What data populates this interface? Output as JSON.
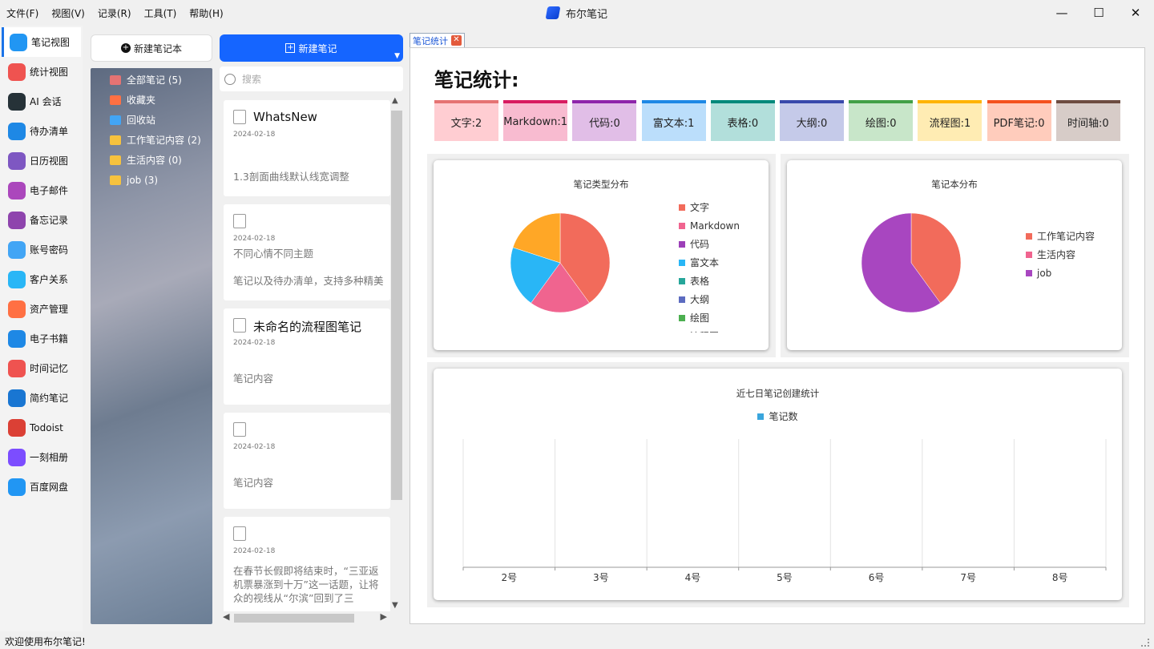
{
  "window": {
    "title": "布尔笔记",
    "menu": [
      "文件(F)",
      "视图(V)",
      "记录(R)",
      "工具(T)",
      "帮助(H)"
    ],
    "controls": {
      "minimize": "—",
      "maximize": "☐",
      "close": "✕"
    }
  },
  "nav": {
    "items": [
      {
        "label": "笔记视图",
        "icon": "note-view-icon",
        "color": "#2196f3"
      },
      {
        "label": "统计视图",
        "icon": "stats-icon",
        "color": "#ef5350"
      },
      {
        "label": "AI 会话",
        "icon": "ai-chat-icon",
        "color": "#263238"
      },
      {
        "label": "待办清单",
        "icon": "todo-icon",
        "color": "#1e88e5"
      },
      {
        "label": "日历视图",
        "icon": "calendar-icon",
        "color": "#7e57c2"
      },
      {
        "label": "电子邮件",
        "icon": "email-icon",
        "color": "#ab47bc"
      },
      {
        "label": "备忘记录",
        "icon": "memo-icon",
        "color": "#8e44ad"
      },
      {
        "label": "账号密码",
        "icon": "password-icon",
        "color": "#42a5f5"
      },
      {
        "label": "客户关系",
        "icon": "customer-icon",
        "color": "#29b6f6"
      },
      {
        "label": "资产管理",
        "icon": "asset-icon",
        "color": "#ff7043"
      },
      {
        "label": "电子书籍",
        "icon": "ebook-icon",
        "color": "#1e88e5"
      },
      {
        "label": "时间记忆",
        "icon": "time-memory-icon",
        "color": "#ef5350"
      },
      {
        "label": "简约笔记",
        "icon": "simple-note-icon",
        "color": "#1976d2"
      },
      {
        "label": "Todoist",
        "icon": "todoist-icon",
        "color": "#db4035"
      },
      {
        "label": "一刻相册",
        "icon": "album-icon",
        "color": "#7c4dff"
      },
      {
        "label": "百度网盘",
        "icon": "baidu-disk-icon",
        "color": "#2196f3"
      }
    ]
  },
  "notebooks": {
    "new_label": "新建笔记本",
    "items": [
      {
        "label": "全部笔记 (5)",
        "icon": "home-icon",
        "color": "#e57373"
      },
      {
        "label": "收藏夹",
        "icon": "favorites-icon",
        "color": "#ff7043"
      },
      {
        "label": "回收站",
        "icon": "trash-icon",
        "color": "#42a5f5"
      },
      {
        "label": "工作笔记内容 (2)",
        "icon": "folder-icon",
        "color": "#f6c23e"
      },
      {
        "label": "生活内容 (0)",
        "icon": "folder-icon",
        "color": "#f6c23e"
      },
      {
        "label": "job (3)",
        "icon": "folder-icon",
        "color": "#f6c23e"
      }
    ]
  },
  "notes": {
    "new_label": "新建笔记",
    "search_placeholder": "搜索",
    "items": [
      {
        "title": "WhatsNew",
        "date": "2024-02-18",
        "body": [
          "1.3剖面曲线默认线宽调整"
        ],
        "icon": "markdown-doc-icon"
      },
      {
        "title": "",
        "date": "2024-02-18",
        "body": [
          "不同心情不同主题",
          "",
          "笔记以及待办清单，支持多种精美"
        ],
        "icon": "text-doc-icon"
      },
      {
        "title": "未命名的流程图笔记",
        "date": "2024-02-18",
        "body": [
          "笔记内容"
        ],
        "icon": "flowchart-icon"
      },
      {
        "title": "",
        "date": "2024-02-18",
        "body": [
          "笔记内容"
        ],
        "icon": "md-icon"
      },
      {
        "title": "",
        "date": "2024-02-18",
        "body": [
          "在春节长假即将结束时，“三亚返",
          "机票暴涨到十万”这一话题，让将",
          "众的视线从“尔滨”回到了三"
        ],
        "icon": "text-doc-icon"
      }
    ]
  },
  "tab": {
    "label": "笔记统计",
    "close": "✕"
  },
  "stats": {
    "heading": "笔记统计:",
    "boxes": [
      {
        "label": "文字:2",
        "bg": "#ffcdd2",
        "border": "#e57373"
      },
      {
        "label": "Markdown:1",
        "bg": "#f8bbd0",
        "border": "#d81b60"
      },
      {
        "label": "代码:0",
        "bg": "#e1bee7",
        "border": "#8e24aa"
      },
      {
        "label": "富文本:1",
        "bg": "#bbdefb",
        "border": "#1e88e5"
      },
      {
        "label": "表格:0",
        "bg": "#b2dfdb",
        "border": "#00897b"
      },
      {
        "label": "大纲:0",
        "bg": "#c5cae9",
        "border": "#3949ab"
      },
      {
        "label": "绘图:0",
        "bg": "#c8e6c9",
        "border": "#43a047"
      },
      {
        "label": "流程图:1",
        "bg": "#ffecb3",
        "border": "#ffb300"
      },
      {
        "label": "PDF笔记:0",
        "bg": "#ffccbc",
        "border": "#f4511e"
      },
      {
        "label": "时间轴:0",
        "bg": "#d7ccc8",
        "border": "#6d4c41"
      }
    ]
  },
  "chart_data": [
    {
      "type": "pie",
      "title": "笔记类型分布",
      "labels": [
        "文字",
        "Markdown",
        "代码",
        "富文本",
        "表格",
        "大纲",
        "绘图",
        "流程图"
      ],
      "values": [
        2,
        1,
        0,
        1,
        0,
        0,
        0,
        1
      ],
      "colors": [
        "#f26b5b",
        "#f0648f",
        "#9c3fb8",
        "#29b6f6",
        "#26a69a",
        "#5c6bc0",
        "#4caf50",
        "#ffa726"
      ],
      "legend": "right"
    },
    {
      "type": "pie",
      "title": "笔记本分布",
      "labels": [
        "工作笔记内容",
        "生活内容",
        "job"
      ],
      "values": [
        2,
        0,
        3
      ],
      "colors": [
        "#f26b5b",
        "#f0648f",
        "#a846c0"
      ],
      "legend": "right"
    },
    {
      "type": "bar",
      "title": "近七日笔记创建统计",
      "categories": [
        "2号",
        "3号",
        "4号",
        "5号",
        "6号",
        "7号",
        "8号"
      ],
      "series": [
        {
          "name": "笔记数",
          "values": [
            0,
            0,
            0,
            0,
            0,
            0,
            0
          ],
          "color": "#3aa6dd"
        }
      ],
      "legend": "top",
      "grid": true
    }
  ],
  "statusbar": {
    "text": "欢迎使用布尔笔记!"
  }
}
